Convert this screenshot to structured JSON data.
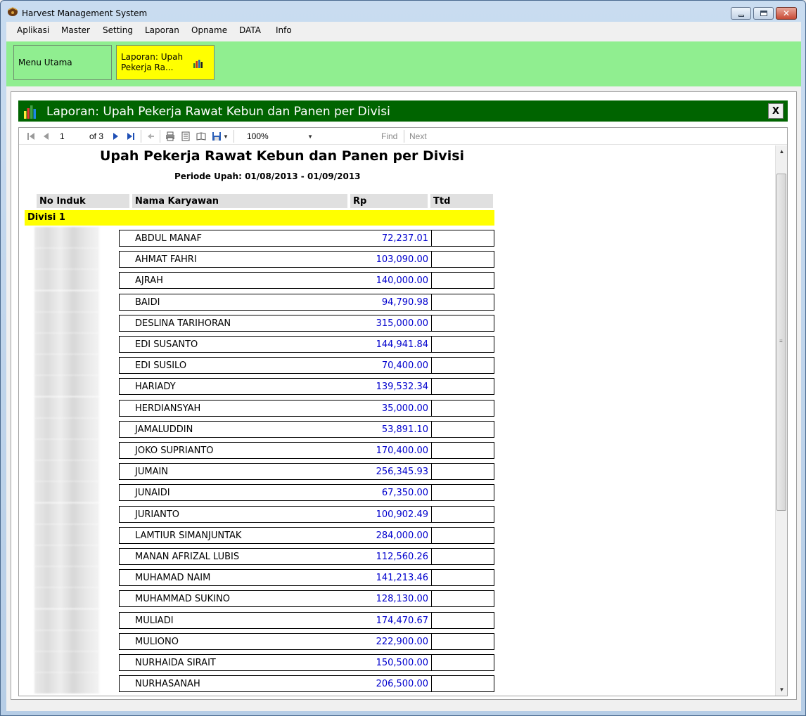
{
  "window": {
    "title": "Harvest Management System"
  },
  "menu": [
    "Aplikasi",
    "Master",
    "Setting",
    "Laporan",
    "Opname",
    "DATA",
    "Info"
  ],
  "tabs": {
    "home_label": "Menu Utama",
    "report_label": "Laporan: Upah Pekerja Ra..."
  },
  "report_header": {
    "title": "Laporan: Upah Pekerja Rawat Kebun dan Panen per Divisi",
    "close_label": "X"
  },
  "toolbar": {
    "page_value": "1",
    "of_label": "of 3",
    "zoom": "100%",
    "find_label": "Find",
    "next_label": "Next"
  },
  "report": {
    "title": "Upah Pekerja Rawat Kebun dan Panen per Divisi",
    "period": "Periode Upah: 01/08/2013 - 01/09/2013",
    "columns": [
      "No Induk",
      "Nama Karyawan",
      "Rp",
      "Ttd"
    ],
    "group": "Divisi 1",
    "rows": [
      {
        "name": "ABDUL MANAF",
        "amount": "72,237.01"
      },
      {
        "name": "AHMAT FAHRI",
        "amount": "103,090.00"
      },
      {
        "name": "AJRAH",
        "amount": "140,000.00"
      },
      {
        "name": "BAIDI",
        "amount": "94,790.98"
      },
      {
        "name": "DESLINA TARIHORAN",
        "amount": "315,000.00"
      },
      {
        "name": "EDI SUSANTO",
        "amount": "144,941.84"
      },
      {
        "name": "EDI SUSILO",
        "amount": "70,400.00"
      },
      {
        "name": "HARIADY",
        "amount": "139,532.34"
      },
      {
        "name": "HERDIANSYAH",
        "amount": "35,000.00"
      },
      {
        "name": "JAMALUDDIN",
        "amount": "53,891.10"
      },
      {
        "name": "JOKO SUPRIANTO",
        "amount": "170,400.00"
      },
      {
        "name": "JUMAIN",
        "amount": "256,345.93"
      },
      {
        "name": "JUNAIDI",
        "amount": "67,350.00"
      },
      {
        "name": "JURIANTO",
        "amount": "100,902.49"
      },
      {
        "name": "LAMTIUR SIMANJUNTAK",
        "amount": "284,000.00"
      },
      {
        "name": "MANAN AFRIZAL LUBIS",
        "amount": "112,560.26"
      },
      {
        "name": "MUHAMAD NAIM",
        "amount": "141,213.46"
      },
      {
        "name": "MUHAMMAD SUKINO",
        "amount": "128,130.00"
      },
      {
        "name": "MULIADI",
        "amount": "174,470.67"
      },
      {
        "name": "MULIONO",
        "amount": "222,900.00"
      },
      {
        "name": "NURHAIDA SIRAIT",
        "amount": "150,500.00"
      },
      {
        "name": "NURHASANAH",
        "amount": "206,500.00"
      }
    ]
  },
  "colors": {
    "tab_strip": "#90ee90",
    "report_header": "#006400",
    "group_band": "#ffff00",
    "amount_text": "#0000cd"
  }
}
